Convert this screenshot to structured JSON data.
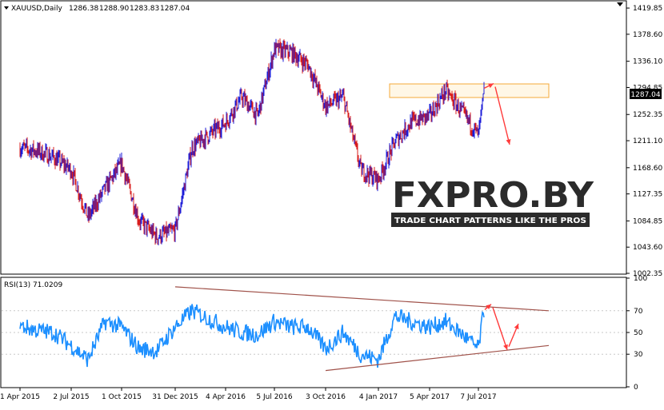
{
  "window": {
    "symbol_line": "XAUUSD,Daily",
    "ohlc": [
      "1286.38",
      "1288.90",
      "1283.83",
      "1287.04"
    ],
    "current_price_label": "1287.04"
  },
  "watermark": {
    "brand": "FXPRO.BY",
    "tagline": "TRADE CHART PATTERNS LIKE THE PROS"
  },
  "colors": {
    "bull_bar": "#1c1cd8",
    "bear_bar": "#d81c1c",
    "rsi_line": "#1e90ff",
    "trendline": "#a0524a",
    "arrow": "#ff3b3b",
    "resistance_zone": "#f4a838",
    "axis": "#000000",
    "price_tag_bg": "#000000",
    "price_tag_text": "#ffffff"
  },
  "chart_data": [
    {
      "type": "candlestick",
      "x_tick_labels": [
        "1 Apr 2015",
        "2 Jul 2015",
        "1 Oct 2015",
        "31 Dec 2015",
        "4 Apr 2016",
        "5 Jul 2016",
        "3 Oct 2016",
        "4 Jan 2017",
        "5 Apr 2017",
        "7 Jul 2017"
      ],
      "y_tick_labels": [
        "1419.85",
        "1378.60",
        "1336.10",
        "1294.85",
        "1252.35",
        "1211.10",
        "1168.60",
        "1127.35",
        "1084.85",
        "1043.60",
        "1002.35"
      ],
      "ylim": [
        1002.35,
        1430
      ],
      "close_path": [
        [
          "1 Apr 2015",
          1200
        ],
        [
          "1 May 2015",
          1195
        ],
        [
          "1 Jun 2015",
          1185
        ],
        [
          "2 Jul 2015",
          1165
        ],
        [
          "1 Aug 2015",
          1090
        ],
        [
          "1 Sep 2015",
          1135
        ],
        [
          "1 Oct 2015",
          1175
        ],
        [
          "1 Nov 2015",
          1085
        ],
        [
          "1 Dec 2015",
          1060
        ],
        [
          "31 Dec 2015",
          1070
        ],
        [
          "1 Feb 2016",
          1200
        ],
        [
          "4 Apr 2016",
          1240
        ],
        [
          "1 May 2016",
          1280
        ],
        [
          "1 Jun 2016",
          1250
        ],
        [
          "5 Jul 2016",
          1355
        ],
        [
          "1 Aug 2016",
          1350
        ],
        [
          "1 Sep 2016",
          1330
        ],
        [
          "3 Oct 2016",
          1265
        ],
        [
          "1 Nov 2016",
          1280
        ],
        [
          "1 Dec 2016",
          1165
        ],
        [
          "4 Jan 2017",
          1150
        ],
        [
          "1 Feb 2017",
          1210
        ],
        [
          "1 Mar 2017",
          1240
        ],
        [
          "5 Apr 2017",
          1250
        ],
        [
          "1 May 2017",
          1290
        ],
        [
          "1 Jun 2017",
          1255
        ],
        [
          "7 Jul 2017",
          1220
        ],
        [
          "1 Aug 2017",
          1287.04
        ]
      ],
      "resistance_zone": [
        1284,
        1300
      ],
      "projection_arrow": {
        "from": 1296,
        "to": 1205
      }
    },
    {
      "type": "line",
      "name": "RSI(13)",
      "header": "RSI(13) 71.0209",
      "ylim": [
        0,
        100
      ],
      "y_tick_labels": [
        "100",
        "70",
        "50",
        "30",
        "0"
      ],
      "levels": [
        30,
        50,
        70
      ],
      "series": [
        [
          "1 Apr 2015",
          56
        ],
        [
          "1 May 2015",
          52
        ],
        [
          "1 Jun 2015",
          50
        ],
        [
          "2 Jul 2015",
          38
        ],
        [
          "1 Aug 2015",
          25
        ],
        [
          "1 Sep 2015",
          60
        ],
        [
          "1 Oct 2015",
          55
        ],
        [
          "1 Nov 2015",
          35
        ],
        [
          "1 Dec 2015",
          33
        ],
        [
          "31 Dec 2015",
          55
        ],
        [
          "1 Feb 2016",
          70
        ],
        [
          "4 Apr 2016",
          55
        ],
        [
          "1 May 2016",
          50
        ],
        [
          "1 Jun 2016",
          48
        ],
        [
          "5 Jul 2016",
          60
        ],
        [
          "1 Aug 2016",
          55
        ],
        [
          "1 Sep 2016",
          55
        ],
        [
          "3 Oct 2016",
          35
        ],
        [
          "1 Nov 2016",
          50
        ],
        [
          "1 Dec 2016",
          30
        ],
        [
          "4 Jan 2017",
          25
        ],
        [
          "1 Feb 2017",
          65
        ],
        [
          "1 Mar 2017",
          60
        ],
        [
          "5 Apr 2017",
          55
        ],
        [
          "1 May 2017",
          60
        ],
        [
          "1 Jun 2017",
          48
        ],
        [
          "7 Jul 2017",
          35
        ],
        [
          "1 Aug 2017",
          71.0209
        ]
      ],
      "upper_trendline": [
        [
          "31 Dec 2015",
          92
        ],
        [
          "1 Sep 2017",
          70
        ]
      ],
      "lower_trendline": [
        [
          "3 Oct 2016",
          15
        ],
        [
          "1 Sep 2017",
          38
        ]
      ]
    }
  ]
}
